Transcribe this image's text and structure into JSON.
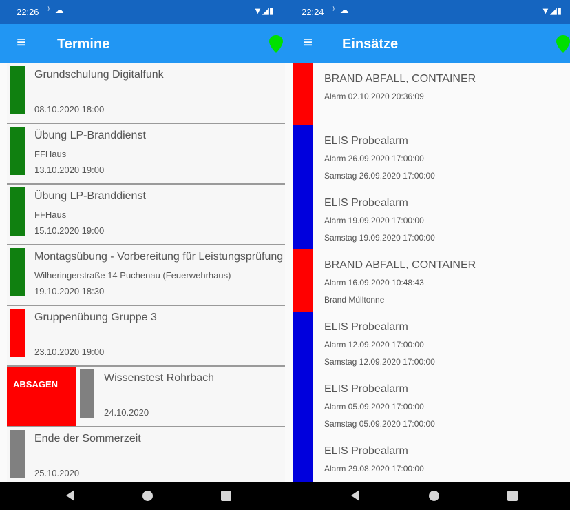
{
  "colors": {
    "status_bar": "#1565c0",
    "app_bar": "#2196f3",
    "location_pin": "#00e000",
    "green": "#108010",
    "red": "#ff0000",
    "grey": "#808080",
    "blue": "#0000dd",
    "absagen": "#ff0000"
  },
  "left": {
    "status": {
      "time": "22:26",
      "left_icons": "⁾ ☁",
      "right_icons": "▼◢▮"
    },
    "appbar": {
      "menu_icon": "menu-icon",
      "title": "Termine",
      "pin_icon": "location-pin-icon"
    },
    "termine": [
      {
        "title": "Grundschulung Digitalfunk",
        "location": "",
        "date": "08.10.2020 18:00",
        "color": "#108010"
      },
      {
        "title": "Übung LP-Branddienst",
        "location": "FFHaus",
        "date": "13.10.2020 19:00",
        "color": "#108010"
      },
      {
        "title": "Übung LP-Branddienst",
        "location": "FFHaus",
        "date": "15.10.2020 19:00",
        "color": "#108010"
      },
      {
        "title": "Montagsübung - Vorbereitung für Leistungsprüfung",
        "location": "Wilheringerstraße 14 Puchenau (Feuerwehrhaus)",
        "date": "19.10.2020 18:30",
        "color": "#108010"
      },
      {
        "title": "Gruppenübung Gruppe 3",
        "location": "",
        "date": "23.10.2020 19:00",
        "color": "#ff0000"
      },
      {
        "title": "Wissenstest Rohrbach",
        "location": "",
        "date": "24.10.2020",
        "color": "#808080",
        "swipe_action": "ABSAGEN"
      },
      {
        "title": "Ende der Sommerzeit",
        "location": "",
        "date": "25.10.2020",
        "color": "#808080"
      }
    ]
  },
  "right": {
    "status": {
      "time": "22:24",
      "left_icons": "⁾ ☁",
      "right_icons": "▼◢▮"
    },
    "appbar": {
      "menu_icon": "menu-icon",
      "title": "Einsätze",
      "pin_icon": "location-pin-icon"
    },
    "einsaetze": [
      {
        "title": "BRAND ABFALL, CONTAINER",
        "line1": "Alarm 02.10.2020 20:36:09",
        "line2": "",
        "color": "#ff0000"
      },
      {
        "title": "ELIS Probealarm",
        "line1": "Alarm 26.09.2020 17:00:00",
        "line2": "Samstag 26.09.2020 17:00:00",
        "color": "#0000dd"
      },
      {
        "title": "ELIS Probealarm",
        "line1": "Alarm 19.09.2020 17:00:00",
        "line2": "Samstag 19.09.2020 17:00:00",
        "color": "#0000dd"
      },
      {
        "title": "BRAND ABFALL, CONTAINER",
        "line1": "Alarm 16.09.2020 10:48:43",
        "line2": "Brand Mülltonne",
        "color": "#ff0000"
      },
      {
        "title": "ELIS Probealarm",
        "line1": "Alarm 12.09.2020 17:00:00",
        "line2": "Samstag 12.09.2020 17:00:00",
        "color": "#0000dd"
      },
      {
        "title": "ELIS Probealarm",
        "line1": "Alarm 05.09.2020 17:00:00",
        "line2": "Samstag 05.09.2020 17:00:00",
        "color": "#0000dd"
      },
      {
        "title": "ELIS Probealarm",
        "line1": "Alarm 29.08.2020 17:00:00",
        "line2": "",
        "color": "#0000dd"
      }
    ]
  },
  "navbar": {
    "back_icon": "back-icon",
    "home_icon": "home-icon",
    "recents_icon": "recents-icon"
  }
}
